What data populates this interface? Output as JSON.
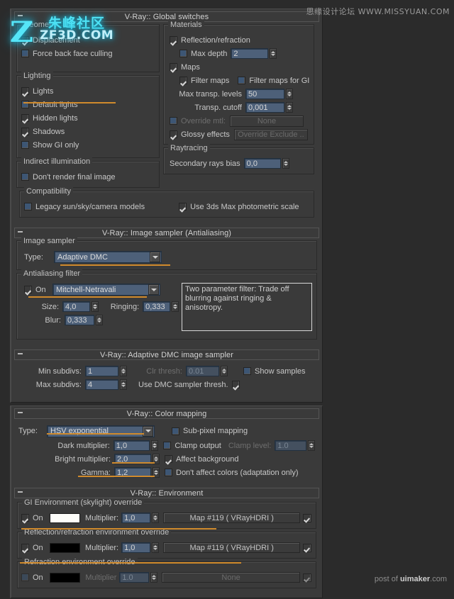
{
  "watermarks": {
    "top_right": "思缘设计论坛  WWW.MISSYUAN.COM",
    "bottom_right_prefix": "post of ",
    "bottom_right_brand": "uimaker",
    "bottom_right_suffix": ".com",
    "logo_zh": "朱峰社区",
    "logo_en": "ZF3D.COM",
    "logo_mark": "Z"
  },
  "global_switches": {
    "title": "V-Ray:: Global switches",
    "geometry": {
      "label": "Geometry",
      "displacement": "Displacement",
      "force_back_face_culling": "Force back face culling"
    },
    "lighting": {
      "label": "Lighting",
      "lights": "Lights",
      "default_lights": "Default lights",
      "hidden_lights": "Hidden lights",
      "shadows": "Shadows",
      "show_gi_only": "Show GI only"
    },
    "indirect_illumination": {
      "label": "Indirect illumination",
      "dont_render_final_image": "Don't render final image"
    },
    "materials": {
      "label": "Materials",
      "reflection_refraction": "Reflection/refraction",
      "max_depth_label": "Max depth",
      "max_depth_value": "2",
      "maps": "Maps",
      "filter_maps": "Filter maps",
      "filter_maps_for_gi": "Filter maps for GI",
      "max_transp_levels_label": "Max transp. levels",
      "max_transp_levels_value": "50",
      "transp_cutoff_label": "Transp. cutoff",
      "transp_cutoff_value": "0,001",
      "override_mtl_label": "Override mtl:",
      "override_mtl_button": "None",
      "glossy_effects": "Glossy effects",
      "override_exclude_button": "Override Exclude .."
    },
    "raytracing": {
      "label": "Raytracing",
      "secondary_rays_bias_label": "Secondary rays bias",
      "secondary_rays_bias_value": "0,0"
    },
    "compatibility": {
      "label": "Compatibility",
      "legacy_sun_sky_camera": "Legacy sun/sky/camera models",
      "use_photometric_scale": "Use 3ds Max photometric scale"
    }
  },
  "image_sampler": {
    "title": "V-Ray:: Image sampler (Antialiasing)",
    "sampler_group_label": "Image sampler",
    "type_label": "Type:",
    "type_value": "Adaptive DMC",
    "aa_filter_group_label": "Antialiasing filter",
    "on_label": "On",
    "filter_value": "Mitchell-Netravali",
    "size_label": "Size:",
    "size_value": "4,0",
    "ringing_label": "Ringing:",
    "ringing_value": "0,333",
    "blur_label": "Blur:",
    "blur_value": "0,333",
    "tip_text": "Two parameter filter: Trade off blurring against ringing & anisotropy."
  },
  "adaptive_dmc": {
    "title": "V-Ray:: Adaptive DMC image sampler",
    "min_subdivs_label": "Min subdivs:",
    "min_subdivs_value": "1",
    "max_subdivs_label": "Max subdivs:",
    "max_subdivs_value": "4",
    "clr_thresh_label": "Clr thresh:",
    "clr_thresh_value": "0.01",
    "use_dmc_sampler_thresh": "Use DMC sampler thresh.",
    "show_samples": "Show samples"
  },
  "color_mapping": {
    "title": "V-Ray:: Color mapping",
    "type_label": "Type:",
    "type_value": "HSV exponential",
    "dark_multiplier_label": "Dark multiplier:",
    "dark_multiplier_value": "1,0",
    "bright_multiplier_label": "Bright multiplier:",
    "bright_multiplier_value": "2,0",
    "gamma_label": "Gamma:",
    "gamma_value": "1,2",
    "sub_pixel_mapping": "Sub-pixel mapping",
    "clamp_output": "Clamp output",
    "clamp_level_label": "Clamp level:",
    "clamp_level_value": "1.0",
    "affect_background": "Affect background",
    "dont_affect_colors": "Don't affect colors (adaptation only)"
  },
  "environment": {
    "title": "V-Ray:: Environment",
    "gi": {
      "label": "GI Environment (skylight) override",
      "on": "On",
      "color": "#fdfdfa",
      "multiplier_label": "Multiplier:",
      "multiplier_value": "1,0",
      "map_button": "Map #119  ( VRayHDRI )"
    },
    "reflection": {
      "label": "Reflection/refraction environment override",
      "on": "On",
      "color": "#000000",
      "multiplier_label": "Multiplier:",
      "multiplier_value": "1,0",
      "map_button": "Map #119  ( VRayHDRI )"
    },
    "refraction": {
      "label": "Refraction environment override",
      "on": "On",
      "color": "#000000",
      "multiplier_label": "Multiplier",
      "multiplier_value": "1.0",
      "map_button": "None"
    }
  }
}
